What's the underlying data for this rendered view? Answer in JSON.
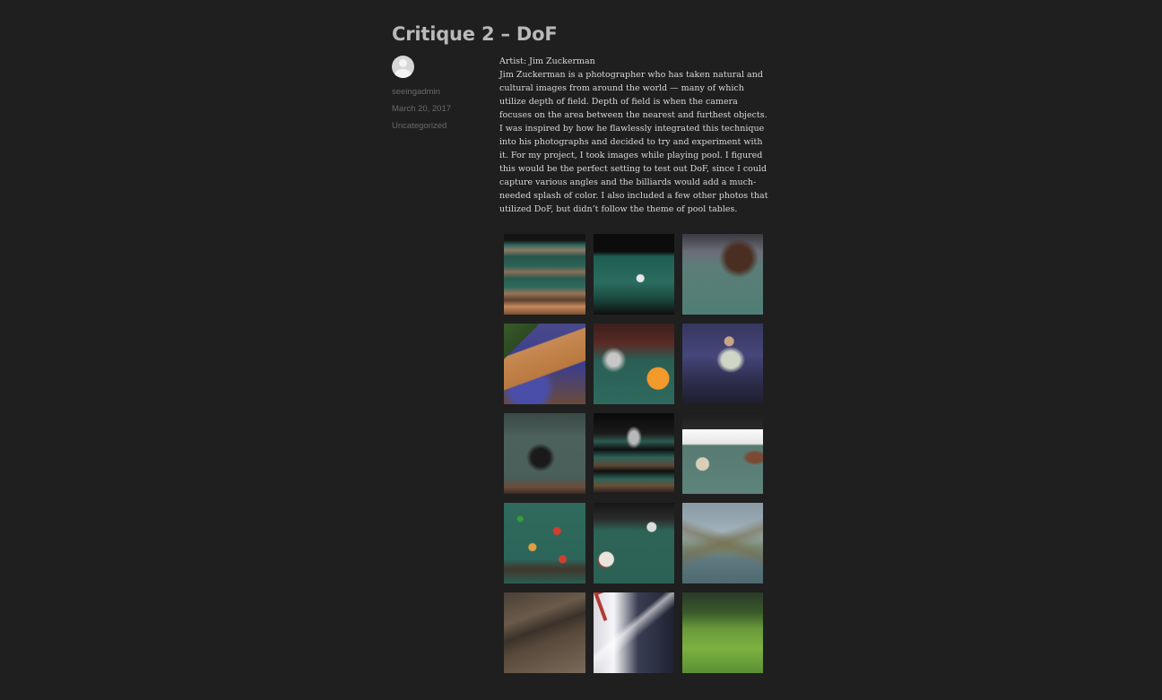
{
  "post": {
    "title": "Critique 2 – DoF"
  },
  "meta": {
    "author": "seeingadmin",
    "date": "March 20, 2017",
    "category": "Uncategorized"
  },
  "content": {
    "artist_line": "Artist: Jim Zuckerman",
    "body": "Jim Zuckerman is a photographer who has taken natural and cultural images from around the world — many of which utilize depth of field. Depth of field is when the camera focuses on the area between the nearest and furthest objects. I was inspired by how he flawlessly integrated this technique into his photographs and decided to try and experiment with it. For my project, I took images while playing pool. I figured this would be the perfect setting to test out DoF, since I could capture various angles and the billiards would add a much-needed splash of color. I also included a few other photos that utilized DoF, but didn’t follow the theme of pool tables."
  },
  "colors": {
    "background": "#1f1f1f",
    "title": "#b9b9b9",
    "meta": "#6a6a6a",
    "body_text": "#d8d8d8"
  }
}
